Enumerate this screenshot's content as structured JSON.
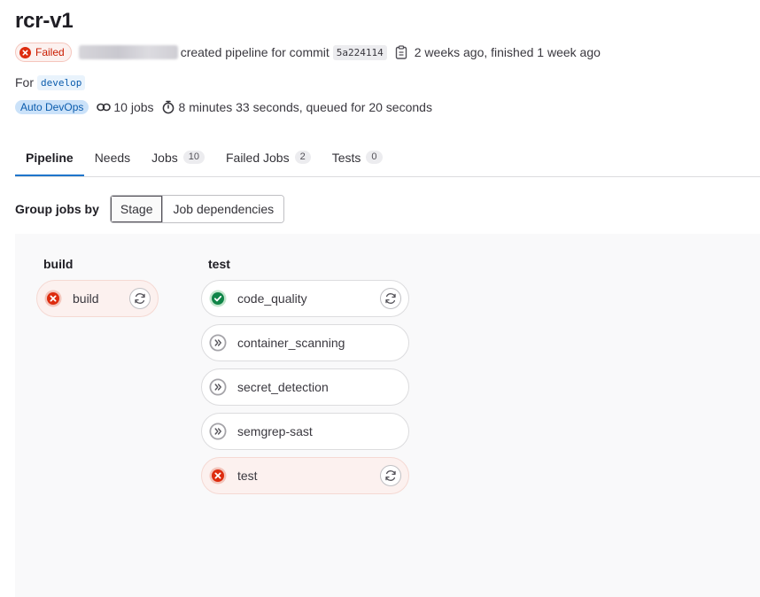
{
  "pipeline": {
    "title": "rcr-v1",
    "status_label": "Failed",
    "created_text": "created pipeline for commit",
    "commit_sha": "5a224114",
    "time_text": "2 weeks ago, finished 1 week ago",
    "for_label": "For",
    "branch": "develop",
    "source_badge": "Auto DevOps",
    "jobs_count_text": "10 jobs",
    "duration_text": "8 minutes 33 seconds, queued for 20 seconds"
  },
  "tabs": [
    {
      "label": "Pipeline",
      "count": null
    },
    {
      "label": "Needs",
      "count": null
    },
    {
      "label": "Jobs",
      "count": "10"
    },
    {
      "label": "Failed Jobs",
      "count": "2"
    },
    {
      "label": "Tests",
      "count": "0"
    }
  ],
  "grouping": {
    "label": "Group jobs by",
    "options": [
      "Stage",
      "Job dependencies"
    ],
    "selected": "Stage"
  },
  "stages": [
    {
      "name": "build",
      "jobs": [
        {
          "name": "build",
          "status": "failed",
          "icon": "status-failed-icon",
          "retry": true
        }
      ]
    },
    {
      "name": "test",
      "jobs": [
        {
          "name": "code_quality",
          "status": "success",
          "icon": "status-success-icon",
          "retry": true
        },
        {
          "name": "container_scanning",
          "status": "skipped",
          "icon": "status-skipped-icon",
          "retry": false
        },
        {
          "name": "secret_detection",
          "status": "skipped",
          "icon": "status-skipped-icon",
          "retry": false
        },
        {
          "name": "semgrep-sast",
          "status": "skipped",
          "icon": "status-skipped-icon",
          "retry": false
        },
        {
          "name": "test",
          "status": "failed",
          "icon": "status-failed-icon",
          "retry": true
        }
      ]
    }
  ],
  "colors": {
    "failed": "#dd2b0e",
    "success": "#108548",
    "skipped": "#a4a3a8",
    "accent": "#1f75cb"
  }
}
